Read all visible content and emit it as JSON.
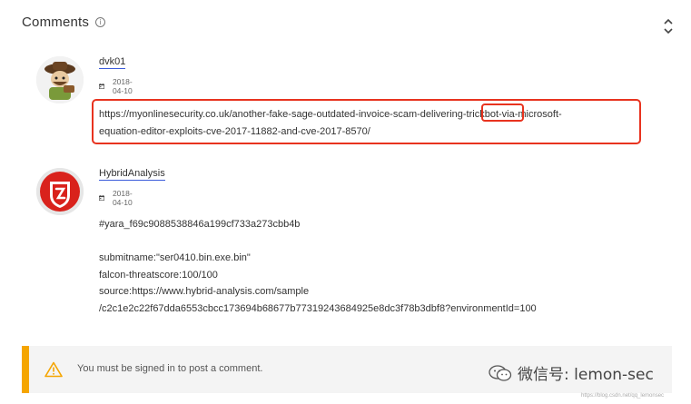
{
  "header": {
    "title": "Comments",
    "info_icon": "info-icon",
    "collapse_icon": "chevron-collapse-icon"
  },
  "comments": [
    {
      "author": "dvk01",
      "date": "2018-04-10",
      "avatar": "cartoon-avatar",
      "lines": [
        "https://myonlinesecurity.co.uk/another-fake-sage-outdated-invoice-scam-delivering-trickbot-via-microsoft-",
        "equation-editor-exploits-cve-2017-11882-and-cve-2017-8570/"
      ]
    },
    {
      "author": "HybridAnalysis",
      "date": "2018-04-10",
      "avatar": "hybrid-analysis-logo",
      "lines": [
        "#yara_f69c9088538846a199cf733a273cbb4b",
        "",
        "submitname:\"ser0410.bin.exe.bin\"",
        "falcon-threatscore:100/100",
        "source:https://www.hybrid-analysis.com/sample",
        "/c2c1e2c22f67dda6553cbcc173694b68677b77319243684925e8dc3f78b3dbf8?environmentId=100"
      ]
    }
  ],
  "signin_notice": {
    "text": "You must be signed in to post a comment.",
    "icon": "warning-icon",
    "accent_color": "#f5a500"
  },
  "annotation_color": "#e8331f",
  "watermark": {
    "text": "微信号: lemon-sec",
    "url": "https://blog.csdn.net/qq_lemonsec"
  }
}
